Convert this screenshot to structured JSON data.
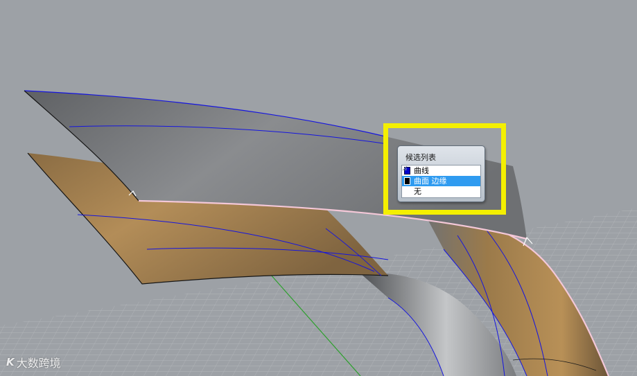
{
  "selection_popup": {
    "title": "候选列表",
    "items": [
      {
        "label": "曲线",
        "swatch_color": "#0000cc",
        "selected": false
      },
      {
        "label": "曲面 边缘",
        "swatch_color": "#000000",
        "selected": true
      },
      {
        "label": "无",
        "swatch_color": "",
        "selected": false
      }
    ]
  },
  "highlight_color": "#f4ef00",
  "watermark": {
    "logo": "K",
    "text": "大数跨境"
  },
  "colors": {
    "background": "#9da1a6",
    "surface_gray": "#7d7f82",
    "surface_tan": "#a7824f",
    "isocurve_blue": "#1414e0",
    "selected_edge": "#f4c8d8",
    "grid_line": "#b9bcbf",
    "grid_axis": "#2da02d"
  }
}
